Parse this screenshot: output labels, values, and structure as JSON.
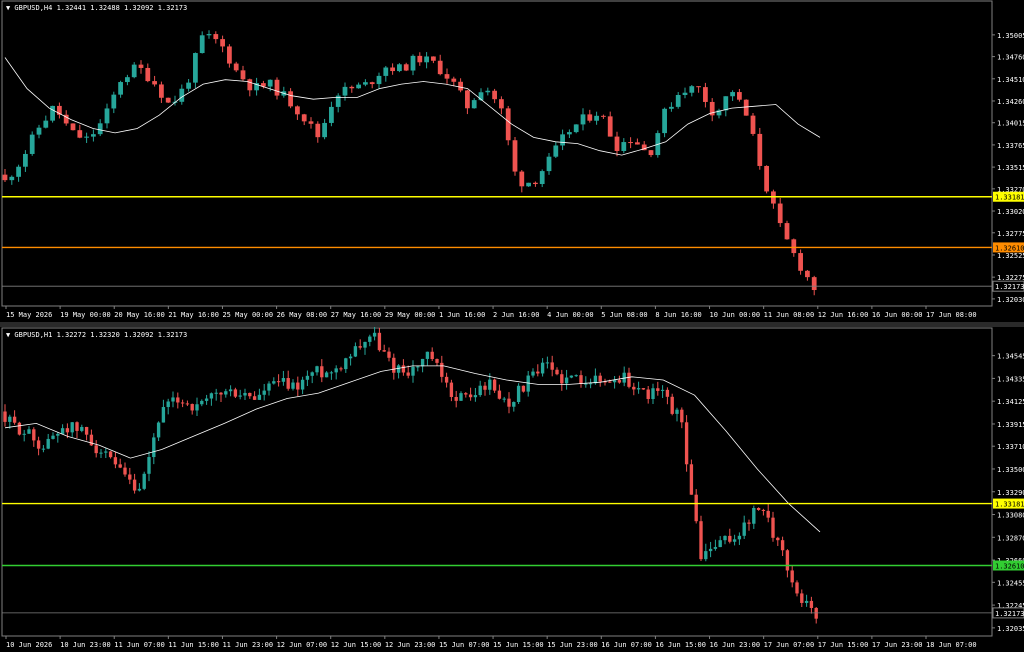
{
  "window": {
    "title": "GBPUSD"
  },
  "colors": {
    "bull": "#26a69a",
    "bear": "#ef5350",
    "ma": "#ffffff",
    "grid": "#808080",
    "text": "#ffffff",
    "yellow": "#ffff00",
    "orange": "#ff8c00",
    "green": "#32cd32"
  },
  "chart_data": [
    {
      "type": "candlestick",
      "header": "GBPUSD,H4  1.32441 1.32488 1.32092 1.32173",
      "ylim": [
        1.3195,
        1.3524
      ],
      "y_ticks": [
        "1.35005",
        "1.34760",
        "1.34510",
        "1.34260",
        "1.34015",
        "1.33765",
        "1.33515",
        "1.33270",
        "1.33020",
        "1.32775",
        "1.32525",
        "1.32275",
        "1.32030"
      ],
      "x_ticks": [
        "15 May 2026",
        "19 May 00:00",
        "20 May 16:00",
        "21 May 16:00",
        "25 May 00:00",
        "26 May 08:00",
        "27 May 16:00",
        "29 May 00:00",
        "1 Jun 16:00",
        "2 Jun 16:00",
        "4 Jun 00:00",
        "5 Jun 08:00",
        "8 Jun 16:00",
        "10 Jun 00:00",
        "11 Jun 08:00",
        "12 Jun 16:00",
        "16 Jun 00:00",
        "17 Jun 08:00"
      ],
      "levels": [
        {
          "value": 1.33181,
          "label": "1.33181",
          "color": "yellow"
        },
        {
          "value": 1.3261,
          "label": "1.32610",
          "color": "orange"
        },
        {
          "value": 1.32173,
          "label": "1.32173",
          "color": "grey"
        }
      ],
      "anchors": [
        1.3335,
        1.336,
        1.3395,
        1.342,
        1.339,
        1.3382,
        1.3405,
        1.345,
        1.3465,
        1.3448,
        1.342,
        1.3445,
        1.35,
        1.3492,
        1.346,
        1.344,
        1.3445,
        1.343,
        1.341,
        1.3385,
        1.3435,
        1.344,
        1.3445,
        1.3465,
        1.3462,
        1.3475,
        1.3468,
        1.345,
        1.342,
        1.3445,
        1.342,
        1.3335,
        1.3335,
        1.336,
        1.339,
        1.3405,
        1.3415,
        1.3375,
        1.3385,
        1.3365,
        1.3415,
        1.344,
        1.344,
        1.341,
        1.344,
        1.3405,
        1.3335,
        1.328,
        1.3245,
        1.3215
      ],
      "ma": [
        1.3475,
        1.344,
        1.3418,
        1.3405,
        1.3395,
        1.339,
        1.3395,
        1.341,
        1.343,
        1.3445,
        1.345,
        1.3448,
        1.344,
        1.3432,
        1.3428,
        1.343,
        1.343,
        1.344,
        1.3445,
        1.3448,
        1.3445,
        1.344,
        1.342,
        1.34,
        1.3385,
        1.338,
        1.3378,
        1.337,
        1.3365,
        1.3372,
        1.338,
        1.34,
        1.3412,
        1.3418,
        1.342,
        1.3422,
        1.34,
        1.3385
      ],
      "candles": 120
    },
    {
      "type": "candlestick",
      "header": "GBPUSD,H1  1.32272 1.32320 1.32092 1.32173",
      "ylim": [
        1.3196,
        1.3468
      ],
      "y_ticks": [
        "1.34545",
        "1.34335",
        "1.34125",
        "1.33915",
        "1.33710",
        "1.33500",
        "1.33290",
        "1.33080",
        "1.32870",
        "1.32660",
        "1.32455",
        "1.32245",
        "1.32035"
      ],
      "x_ticks": [
        "10 Jun 2026",
        "10 Jun 23:00",
        "11 Jun 07:00",
        "11 Jun 15:00",
        "11 Jun 23:00",
        "12 Jun 07:00",
        "12 Jun 15:00",
        "12 Jun 23:00",
        "15 Jun 07:00",
        "15 Jun 15:00",
        "15 Jun 23:00",
        "16 Jun 07:00",
        "16 Jun 15:00",
        "16 Jun 23:00",
        "17 Jun 07:00",
        "17 Jun 15:00",
        "17 Jun 23:00",
        "18 Jun 07:00"
      ],
      "levels": [
        {
          "value": 1.33181,
          "label": "1.33181",
          "color": "yellow"
        },
        {
          "value": 1.3261,
          "label": "1.32610",
          "color": "green"
        },
        {
          "value": 1.32173,
          "label": "1.32173",
          "color": "grey"
        }
      ],
      "anchors": [
        1.3395,
        1.3385,
        1.337,
        1.339,
        1.3385,
        1.3365,
        1.3345,
        1.3325,
        1.34,
        1.3415,
        1.3405,
        1.342,
        1.342,
        1.3415,
        1.343,
        1.3425,
        1.344,
        1.344,
        1.346,
        1.3475,
        1.3445,
        1.344,
        1.3455,
        1.342,
        1.3415,
        1.343,
        1.341,
        1.343,
        1.3445,
        1.3432,
        1.3435,
        1.343,
        1.3435,
        1.342,
        1.342,
        1.3395,
        1.327,
        1.328,
        1.329,
        1.3315,
        1.3285,
        1.3235,
        1.3217
      ],
      "ma": [
        1.3388,
        1.3392,
        1.338,
        1.3372,
        1.336,
        1.3368,
        1.338,
        1.3392,
        1.3405,
        1.3415,
        1.342,
        1.343,
        1.344,
        1.3445,
        1.3445,
        1.3438,
        1.3432,
        1.3428,
        1.3428,
        1.343,
        1.3435,
        1.3432,
        1.3418,
        1.3385,
        1.335,
        1.3318,
        1.3292
      ],
      "candles": 170
    }
  ]
}
